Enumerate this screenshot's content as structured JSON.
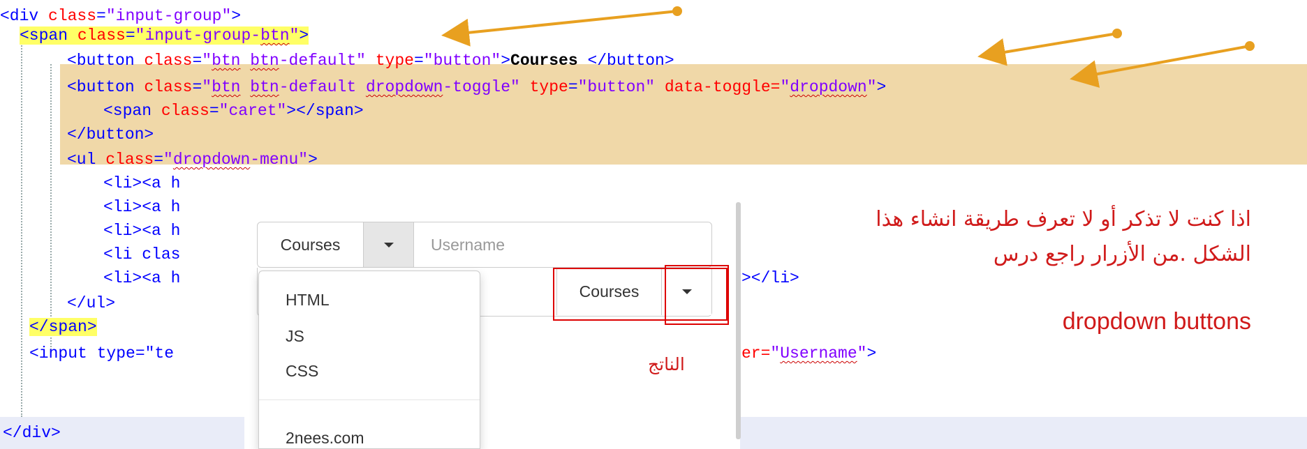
{
  "code": {
    "line1": {
      "open": "<div ",
      "attr": "class",
      "eq": "=",
      "val": "\"input-group\"",
      "close": ">"
    },
    "line2": {
      "open": "<span ",
      "attr": "class",
      "eq": "=",
      "val_a": "\"input-group-",
      "val_b": "btn",
      "val_c": "\"",
      "close": ">"
    },
    "line3": {
      "open": "<button ",
      "attr1": "class",
      "eq": "=",
      "q1": "\"",
      "w1": "btn",
      "sp": " ",
      "w2": "btn",
      "rest1": "-default\"",
      "attr2": " type",
      "val2": "\"button\"",
      "close": ">",
      "text": "Courses ",
      "end": "</button>"
    },
    "line4": {
      "open": "<button ",
      "attr1": "class",
      "eq": "=",
      "q1": "\"",
      "w1": "btn",
      "sp": " ",
      "w2": "btn",
      "mid": "-default ",
      "w3": "dropdown",
      "rest1": "-toggle\"",
      "attr2": " type",
      "val2": "\"button\"",
      "attr3": " data-toggle=",
      "q3": "\"",
      "w4": "dropdown",
      "q4": "\"",
      "close": ">"
    },
    "line5": {
      "open": "<span ",
      "attr": "class",
      "eq": "=",
      "val": "\"caret\"",
      "close": "></span>"
    },
    "line6": {
      "text": "</button>"
    },
    "line7": {
      "open": "<ul ",
      "attr": "class",
      "eq": "=",
      "q": "\"",
      "w": "dropdown",
      "rest": "-menu\"",
      "close": ">"
    },
    "line8": {
      "text": "<li><a h"
    },
    "line9": {
      "text": "<li><a h"
    },
    "line10": {
      "text": "<li><a h"
    },
    "line11": {
      "text": "<li clas"
    },
    "line12": {
      "text": "<li><a h",
      "tail": "></li>"
    },
    "line13": {
      "text": "</ul>"
    },
    "line14": {
      "text": "</span>"
    },
    "line15": {
      "open": "<input type=\"te",
      "tail_attr": "er=",
      "tail_q": "\"",
      "tail_w": "Username",
      "tail_q2": "\"",
      "tail_close": ">"
    },
    "line16": {
      "text": "</div>"
    }
  },
  "preview": {
    "courses_label": "Courses",
    "username_placeholder": "Username",
    "courses_label_2": "Courses",
    "menu_items": [
      "HTML",
      "JS",
      "CSS",
      "2nees.com"
    ]
  },
  "notes": {
    "arabic": "اذا كنت لا تذكر أو لا تعرف طريقة انشاء هذا الشكل .من الأزرار راجع درس",
    "english": "dropdown buttons",
    "result_label": "الناتج"
  },
  "colors": {
    "tag": "#0000ff",
    "attr": "#ff0000",
    "value": "#8000ff",
    "highlight_yellow": "#ffff66",
    "highlight_band": "#f0d8a8",
    "arrow": "#e8a020",
    "annotation_red": "#d01a1a"
  },
  "icons": [
    "arrow-annotation",
    "caret-down-icon"
  ]
}
